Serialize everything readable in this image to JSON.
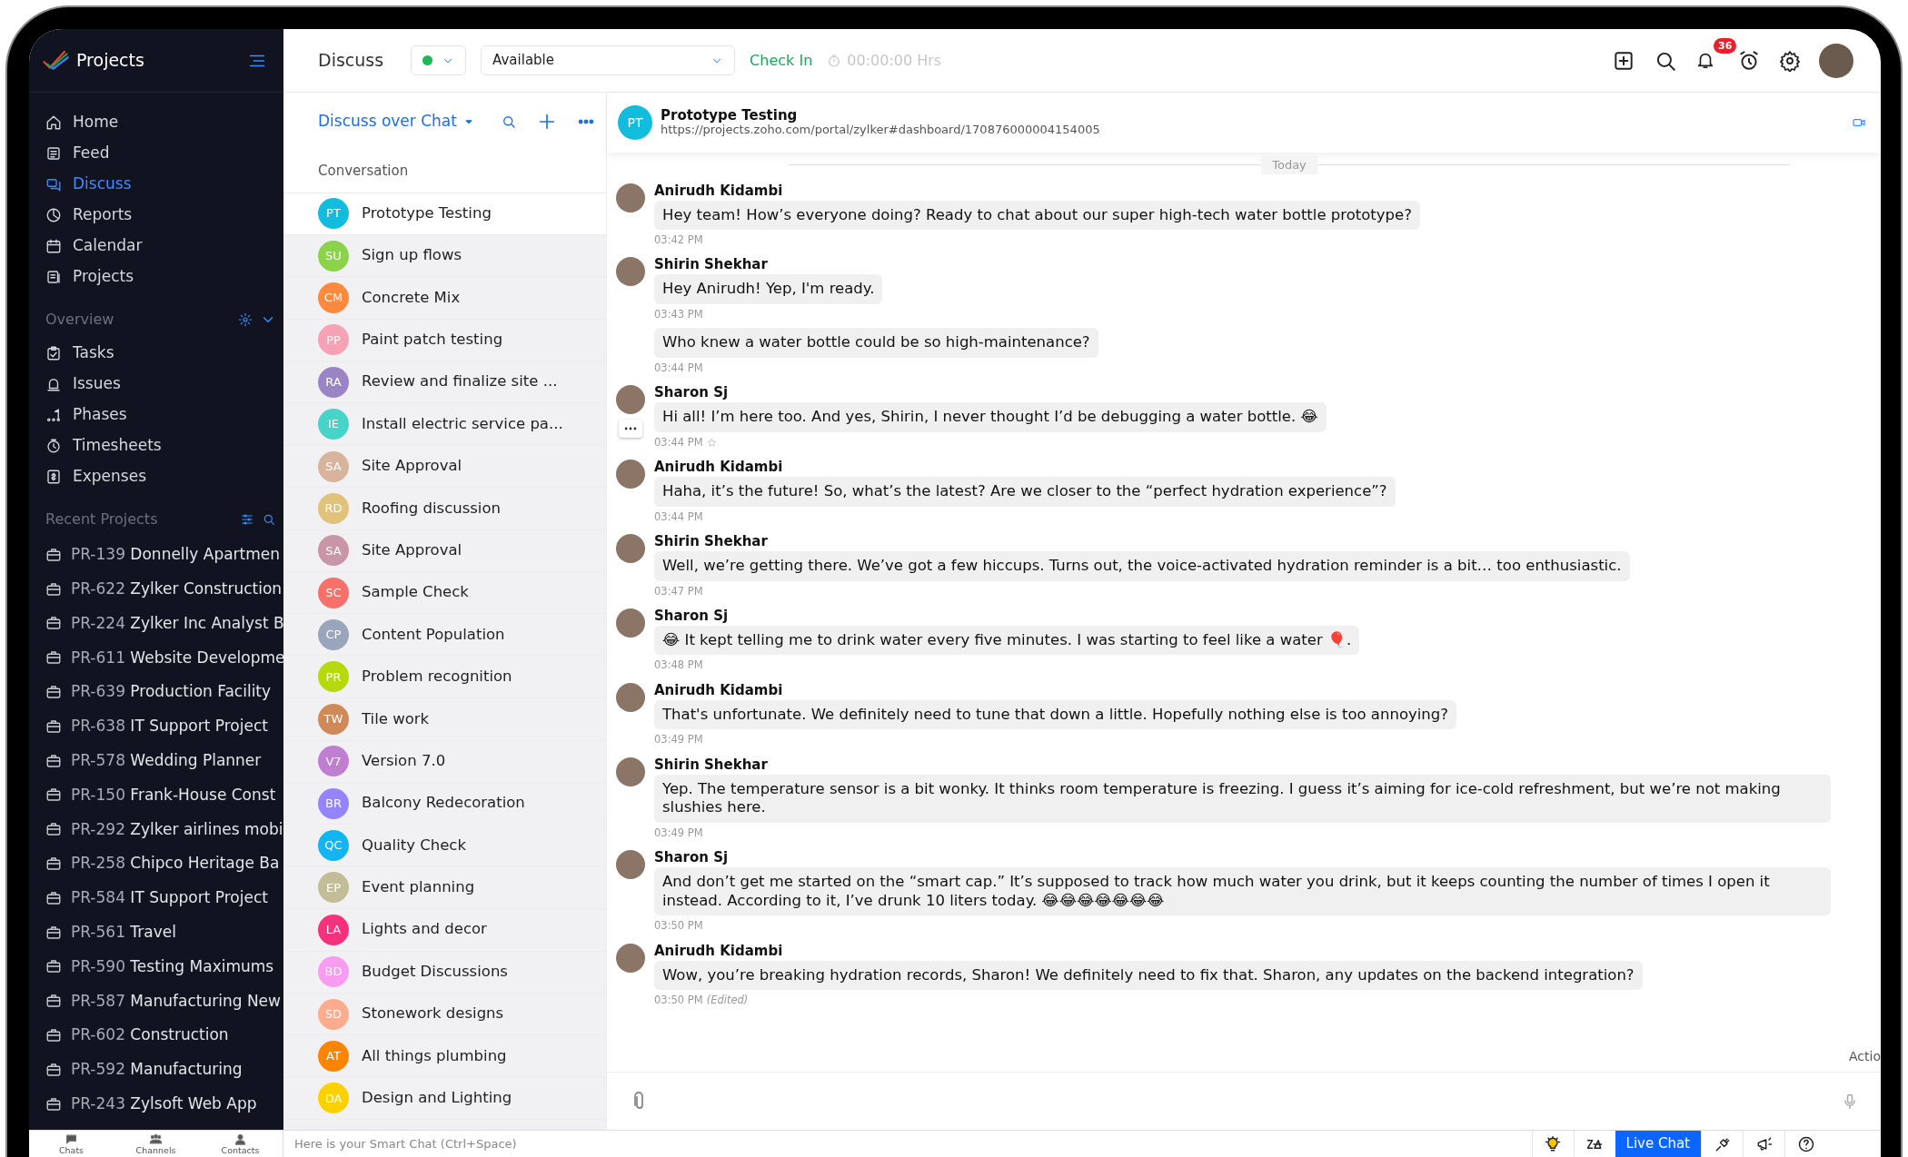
{
  "sidebar": {
    "app_title": "Projects",
    "nav": [
      {
        "label": "Home",
        "selected": false
      },
      {
        "label": "Feed",
        "selected": false
      },
      {
        "label": "Discuss",
        "selected": true
      },
      {
        "label": "Reports",
        "selected": false
      },
      {
        "label": "Calendar",
        "selected": false
      },
      {
        "label": "Projects",
        "selected": false
      }
    ],
    "overview_title": "Overview",
    "overview": [
      {
        "label": "Tasks"
      },
      {
        "label": "Issues"
      },
      {
        "label": "Phases"
      },
      {
        "label": "Timesheets"
      },
      {
        "label": "Expenses"
      }
    ],
    "recent_title": "Recent Projects",
    "recent": [
      {
        "code": "PR-139",
        "name": "Donnelly Apartmen"
      },
      {
        "code": "PR-622",
        "name": "Zylker Construction"
      },
      {
        "code": "PR-224",
        "name": "Zylker Inc Analyst B"
      },
      {
        "code": "PR-611",
        "name": "Website Developme"
      },
      {
        "code": "PR-639",
        "name": "Production Facility"
      },
      {
        "code": "PR-638",
        "name": "IT Support Project"
      },
      {
        "code": "PR-578",
        "name": "Wedding Planner"
      },
      {
        "code": "PR-150",
        "name": "Frank-House Const"
      },
      {
        "code": "PR-292",
        "name": "Zylker airlines mobi"
      },
      {
        "code": "PR-258",
        "name": "Chipco Heritage Ba"
      },
      {
        "code": "PR-584",
        "name": "IT Support Project"
      },
      {
        "code": "PR-561",
        "name": "Travel"
      },
      {
        "code": "PR-590",
        "name": "Testing Maximums"
      },
      {
        "code": "PR-587",
        "name": "Manufacturing New"
      },
      {
        "code": "PR-602",
        "name": "Construction"
      },
      {
        "code": "PR-592",
        "name": "Manufacturing"
      },
      {
        "code": "PR-243",
        "name": "Zylsoft Web App"
      }
    ]
  },
  "topbar": {
    "title": "Discuss",
    "status": "Available",
    "check_in": "Check In",
    "timer": "00:00:00 Hrs",
    "notifications": "36"
  },
  "conversations": {
    "heading": "Discuss over Chat",
    "section": "Conversation",
    "items": [
      {
        "initials": "PT",
        "name": "Prototype Testing",
        "color": "#12bcdc",
        "selected": true
      },
      {
        "initials": "SU",
        "name": "Sign up flows",
        "color": "#8bd34a",
        "selected": false
      },
      {
        "initials": "CM",
        "name": "Concrete Mix",
        "color": "#ff8a3d",
        "selected": false
      },
      {
        "initials": "PP",
        "name": "Paint patch testing",
        "color": "#f7a1b4",
        "selected": false
      },
      {
        "initials": "RA",
        "name": "Review and finalize site ...",
        "color": "#9a84c6",
        "selected": false
      },
      {
        "initials": "IE",
        "name": "Install electric service pa...",
        "color": "#47d3c8",
        "selected": false
      },
      {
        "initials": "SA",
        "name": "Site Approval",
        "color": "#d9b49c",
        "selected": false
      },
      {
        "initials": "RD",
        "name": "Roofing discussion",
        "color": "#e0c27a",
        "selected": false
      },
      {
        "initials": "SA",
        "name": "Site Approval",
        "color": "#c996a8",
        "selected": false
      },
      {
        "initials": "SC",
        "name": "Sample Check",
        "color": "#f7706a",
        "selected": false
      },
      {
        "initials": "CP",
        "name": "Content Population",
        "color": "#99a5ba",
        "selected": false
      },
      {
        "initials": "PR",
        "name": "Problem recognition",
        "color": "#b6d80f",
        "selected": false
      },
      {
        "initials": "TW",
        "name": "Tile work",
        "color": "#d08a5a",
        "selected": false
      },
      {
        "initials": "V7",
        "name": "Version 7.0",
        "color": "#c07ed0",
        "selected": false
      },
      {
        "initials": "BR",
        "name": "Balcony Redecoration",
        "color": "#9584ff",
        "selected": false
      },
      {
        "initials": "QC",
        "name": "Quality Check",
        "color": "#13b4f2",
        "selected": false
      },
      {
        "initials": "EP",
        "name": "Event planning",
        "color": "#c2bd97",
        "selected": false
      },
      {
        "initials": "LA",
        "name": "Lights and decor",
        "color": "#f6327c",
        "selected": false
      },
      {
        "initials": "BD",
        "name": "Budget Discussions",
        "color": "#f79cf0",
        "selected": false
      },
      {
        "initials": "SD",
        "name": "Stonework designs",
        "color": "#ffab8e",
        "selected": false
      },
      {
        "initials": "AT",
        "name": "All things plumbing",
        "color": "#ff8500",
        "selected": false
      },
      {
        "initials": "DA",
        "name": "Design and Lighting",
        "color": "#ffd000",
        "selected": false
      }
    ]
  },
  "chat": {
    "initials": "PT",
    "title": "Prototype Testing",
    "url": "https://projects.zoho.com/portal/zylker#dashboard/170876000004154005",
    "day": "Today",
    "groups": [
      {
        "author": "Anirudh Kidambi",
        "messages": [
          {
            "text": "Hey team! How’s everyone doing? Ready to chat about our super high-tech water bottle prototype?",
            "time": "03:42 PM"
          }
        ]
      },
      {
        "author": "Shirin Shekhar",
        "messages": [
          {
            "text": "Hey Anirudh! Yep, I'm ready.",
            "time": "03:43 PM"
          },
          {
            "text": "Who knew a water bottle could be so high-maintenance?",
            "time": "03:44 PM"
          }
        ]
      },
      {
        "author": "Sharon Sj",
        "messages": [
          {
            "text": "Hi all! I’m here too. And yes, Shirin, I never thought I’d be debugging a water bottle. 😂",
            "time": "03:44 PM",
            "hovered": true
          }
        ]
      },
      {
        "author": "Anirudh Kidambi",
        "messages": [
          {
            "text": "Haha, it’s the future! So, what’s the latest? Are we closer to the “perfect hydration experience”?",
            "time": "03:44 PM"
          }
        ]
      },
      {
        "author": "Shirin Shekhar",
        "messages": [
          {
            "text": "Well, we’re getting there. We’ve got a few hiccups. Turns out, the voice-activated hydration reminder is a bit… too enthusiastic.",
            "time": "03:47 PM"
          }
        ]
      },
      {
        "author": "Sharon Sj",
        "messages": [
          {
            "text": "😂 It kept telling me to drink water every five minutes. I was starting to feel like a water 🎈.",
            "time": "03:48 PM"
          }
        ]
      },
      {
        "author": "Anirudh Kidambi",
        "messages": [
          {
            "text": "That's unfortunate. We definitely need to tune that down a little. Hopefully nothing else is too annoying?",
            "time": "03:49 PM"
          }
        ]
      },
      {
        "author": "Shirin Shekhar",
        "messages": [
          {
            "text": "Yep. The temperature sensor is a bit wonky. It thinks room temperature is freezing. I guess it’s aiming for ice-cold refreshment, but we’re not making slushies here.",
            "time": "03:49 PM"
          }
        ]
      },
      {
        "author": "Sharon Sj",
        "messages": [
          {
            "text": "And don’t get me started on the “smart cap.” It’s supposed to track how much water you drink, but it keeps counting the number of times I open it instead. According to it, I’ve drunk 10 liters today. 😂😂😂😂😂😂😂",
            "time": "03:50 PM"
          }
        ]
      },
      {
        "author": "Anirudh Kidambi",
        "messages": [
          {
            "text": "Wow, you’re breaking hydration records, Sharon! We definitely need to fix that. Sharon, any updates on the backend integration?",
            "time": "03:50 PM",
            "edited": "(Edited)"
          }
        ]
      }
    ],
    "action": "Actio"
  },
  "bottombar": {
    "tabs": [
      {
        "label": "Chats"
      },
      {
        "label": "Channels"
      },
      {
        "label": "Contacts"
      }
    ],
    "smart_chat": "Here is your Smart Chat (Ctrl+Space)",
    "live_chat": "Live Chat"
  }
}
